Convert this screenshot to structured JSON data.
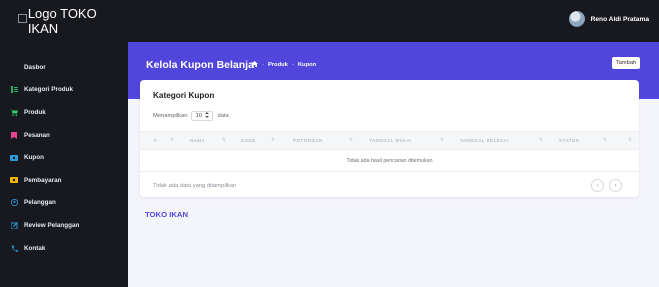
{
  "brand": {
    "logo_alt": "Logo TOKO IKAN"
  },
  "sidebar": {
    "items": [
      {
        "label": "Dasbor",
        "icon": ""
      },
      {
        "label": "Kategori Produk",
        "icon": "list-icon",
        "color": "#27ae60"
      },
      {
        "label": "Produk",
        "icon": "cart-icon",
        "color": "#2ecc71"
      },
      {
        "label": "Pesanan",
        "icon": "bookmark-icon",
        "color": "#e84393"
      },
      {
        "label": "Kupon",
        "icon": "ticket-icon",
        "color": "#2d9cdb"
      },
      {
        "label": "Pembayaran",
        "icon": "wallet-icon",
        "color": "#f2b705"
      },
      {
        "label": "Pelanggan",
        "icon": "user-icon",
        "color": "#2d9cdb"
      },
      {
        "label": "Review Pelanggan",
        "icon": "edit-icon",
        "color": "#2d9cdb"
      },
      {
        "label": "Kontak",
        "icon": "phone-icon",
        "color": "#2d9cdb"
      }
    ]
  },
  "header": {
    "user_name": "Reno Aldi Pratama"
  },
  "page": {
    "title": "Kelola Kupon Belanja",
    "breadcrumb": [
      "Produk",
      "Kupon"
    ],
    "add_button": "Tambah"
  },
  "card": {
    "title": "Kategori Kupon",
    "show_prefix": "Menampilkan",
    "page_length": "10",
    "show_suffix": "data",
    "columns": [
      "#",
      "NAMA",
      "KODE",
      "POTONGAN",
      "TANGGAL MULAI",
      "TANGGAL SELESAI",
      "STATUS"
    ],
    "empty_text": "Tidak ada hasil pencarian ditemukan",
    "info_text": "Tidak ada data yang ditampilkan"
  },
  "footer": {
    "brand": "TOKO IKAN"
  },
  "colors": {
    "sidebar_bg": "#17191f",
    "accent": "#5046dc",
    "page_bg": "#f4f5fa"
  }
}
